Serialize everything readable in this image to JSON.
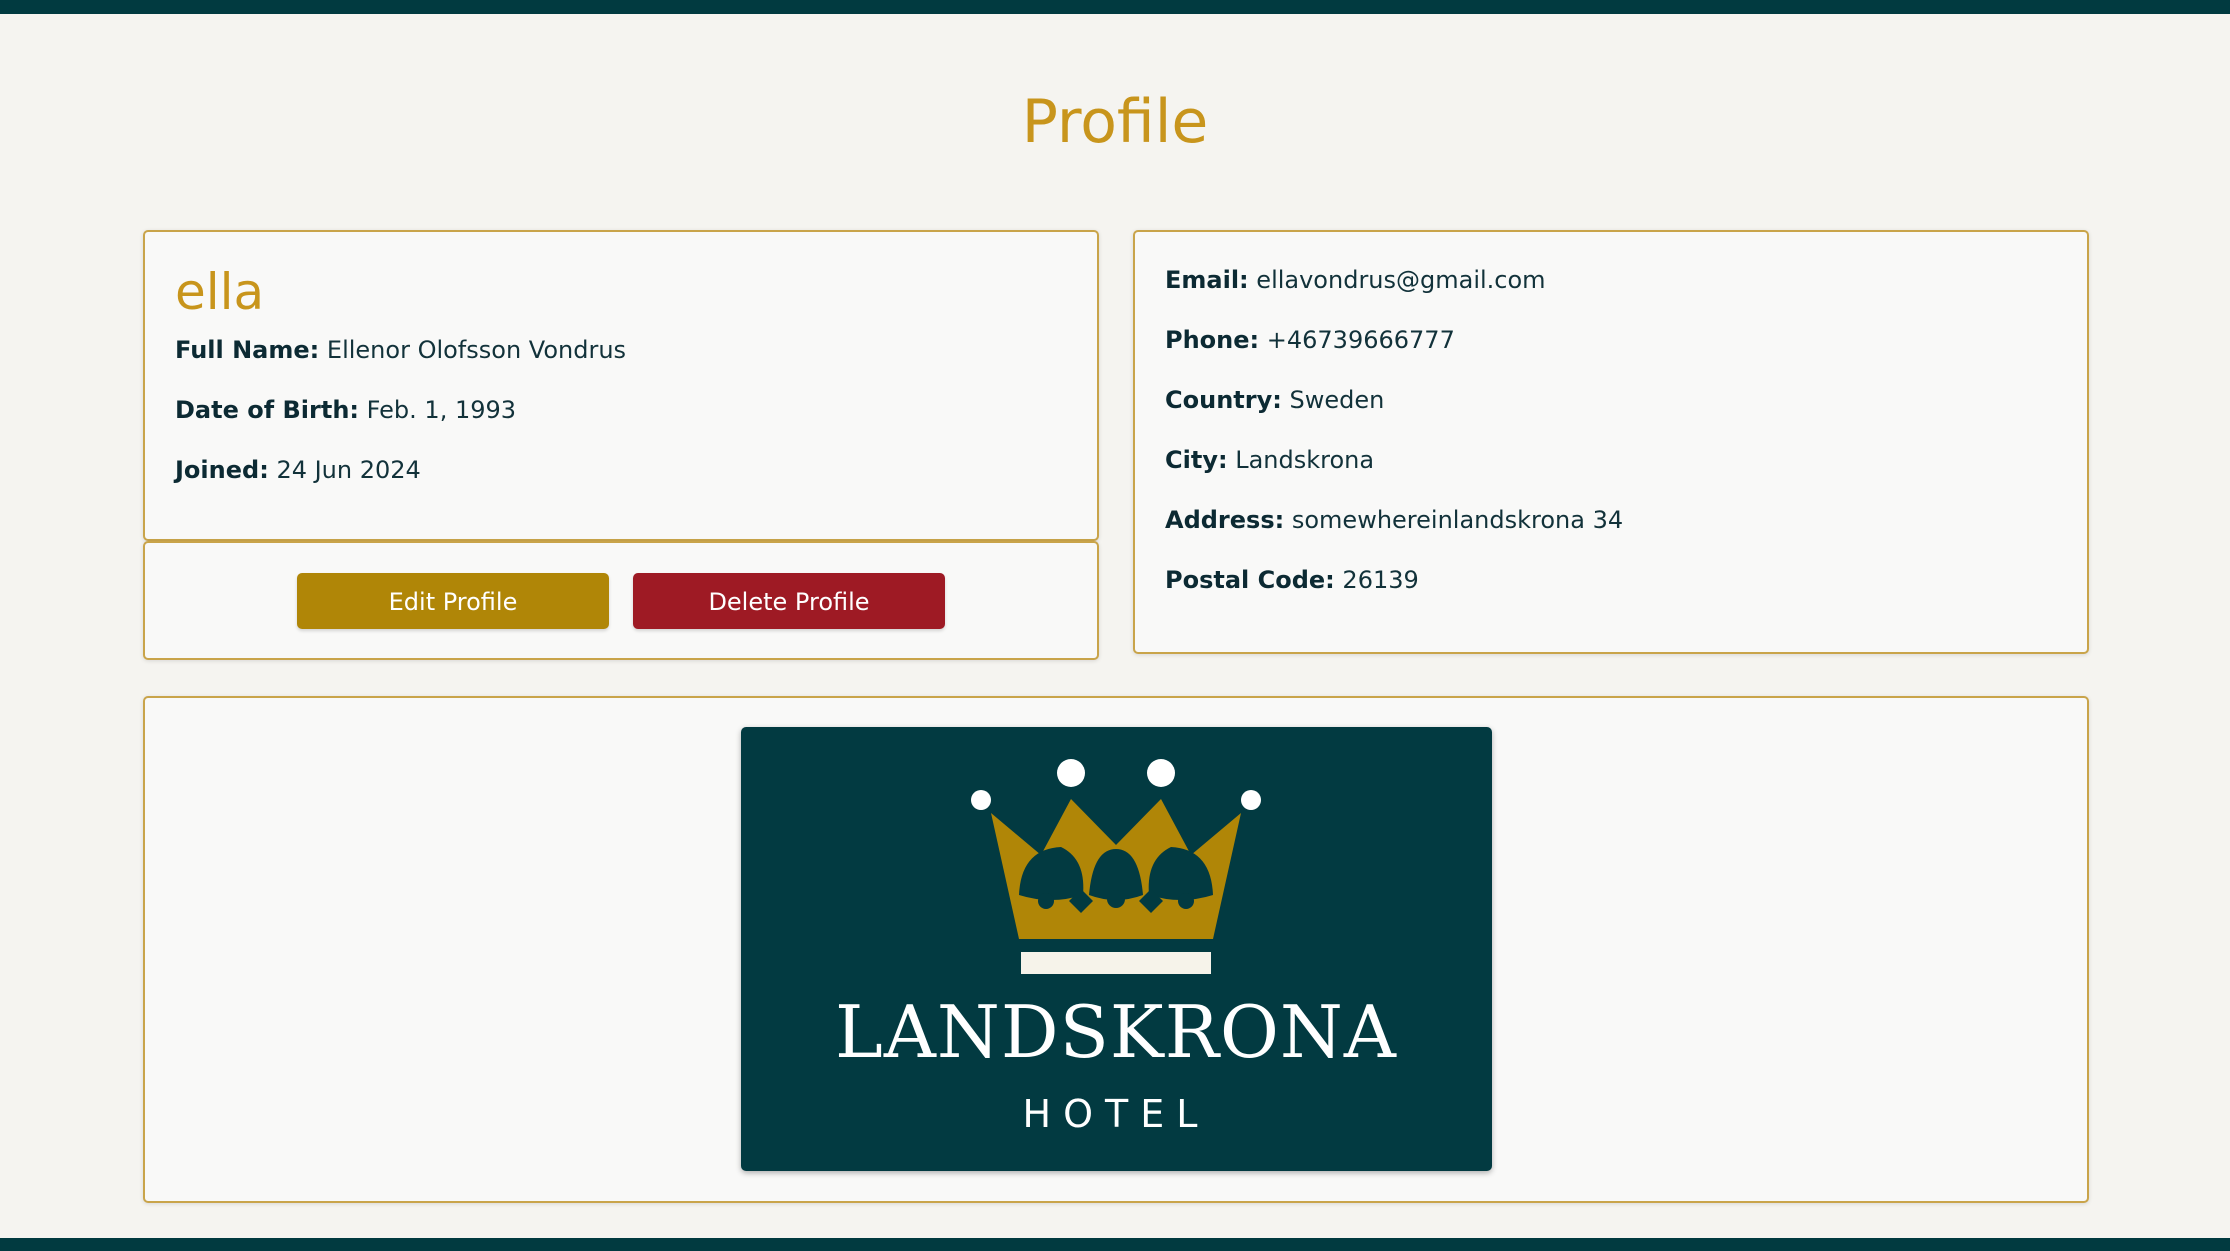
{
  "page": {
    "title": "Profile"
  },
  "user": {
    "username": "ella",
    "full_name_label": "Full Name:",
    "full_name": "Ellenor Olofsson Vondrus",
    "dob_label": "Date of Birth:",
    "dob": "Feb. 1, 1993",
    "joined_label": "Joined:",
    "joined": "24 Jun 2024"
  },
  "actions": {
    "edit_label": "Edit Profile",
    "delete_label": "Delete Profile"
  },
  "contact": {
    "email_label": "Email:",
    "email": "ellavondrus@gmail.com",
    "phone_label": "Phone:",
    "phone": "+46739666777",
    "country_label": "Country:",
    "country": "Sweden",
    "city_label": "City:",
    "city": "Landskrona",
    "address_label": "Address:",
    "address": "somewhereinlandskrona 34",
    "postal_label": "Postal Code:",
    "postal": "26139"
  },
  "logo": {
    "name": "LANDSKRONA",
    "subtitle": "HOTEL",
    "icon": "crown-icon"
  },
  "colors": {
    "header_bar": "#013a40",
    "accent_gold": "#c8951c",
    "edit_button": "#b08607",
    "delete_button": "#9e1a24",
    "logo_background": "#023a41"
  }
}
